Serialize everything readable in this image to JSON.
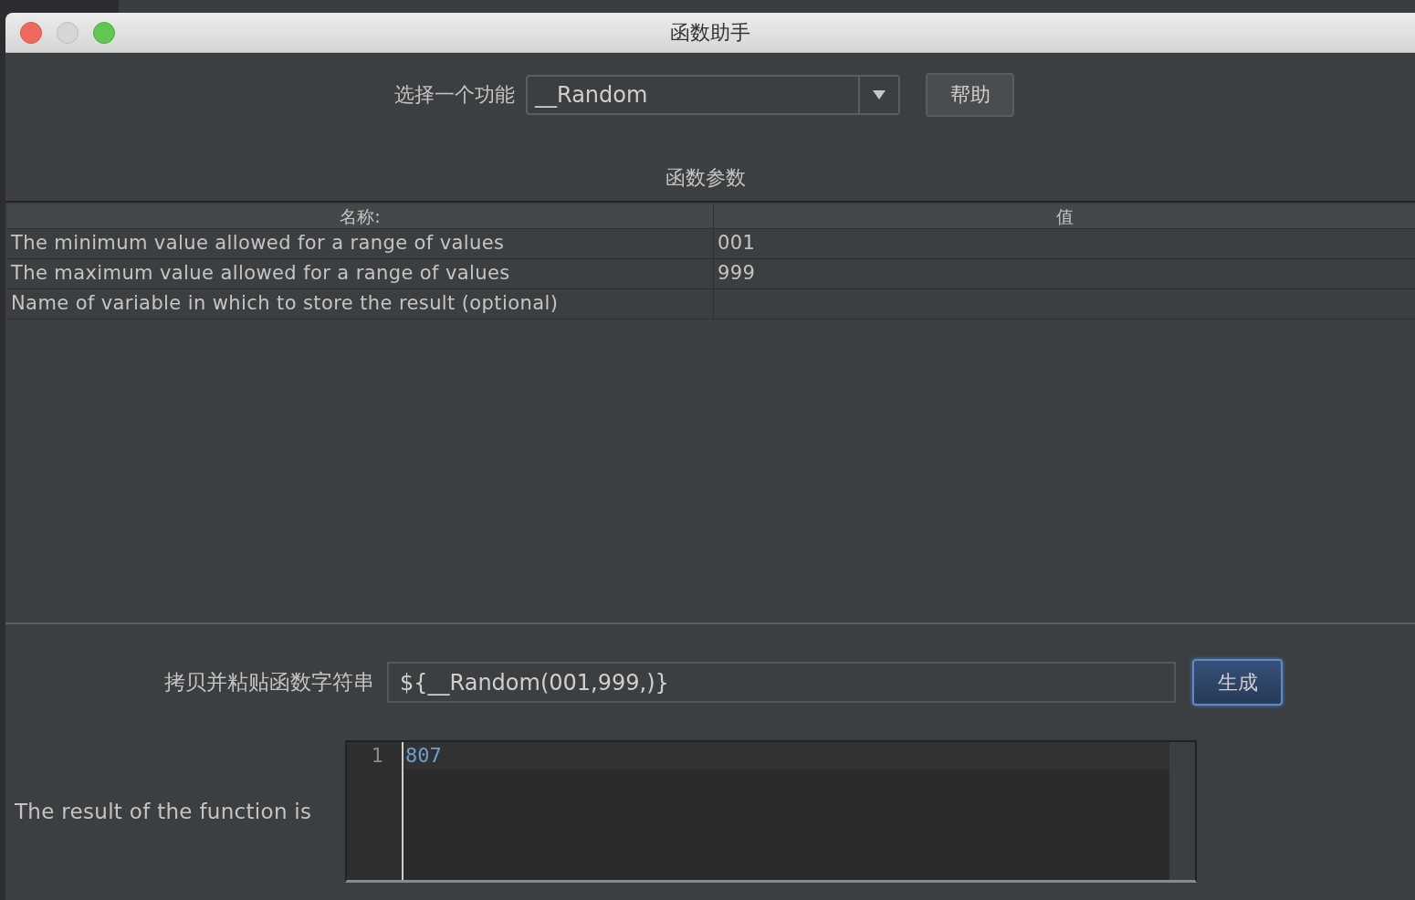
{
  "window": {
    "title": "函数助手"
  },
  "function_select": {
    "label": "选择一个功能",
    "value": "__Random"
  },
  "help_button": "帮助",
  "params": {
    "title": "函数参数",
    "columns": [
      "名称:",
      "值"
    ],
    "rows": [
      {
        "name": "The minimum value allowed for a range of values",
        "value": "001"
      },
      {
        "name": "The maximum value allowed for a range of values",
        "value": "999"
      },
      {
        "name": "Name of variable in which to store the result (optional)",
        "value": ""
      }
    ]
  },
  "output": {
    "label": "拷贝并粘贴函数字符串",
    "value": "${__Random(001,999,)}",
    "button": "生成"
  },
  "result": {
    "label": "The result of the function is",
    "lines": [
      {
        "number": "1",
        "text": "807"
      }
    ]
  }
}
